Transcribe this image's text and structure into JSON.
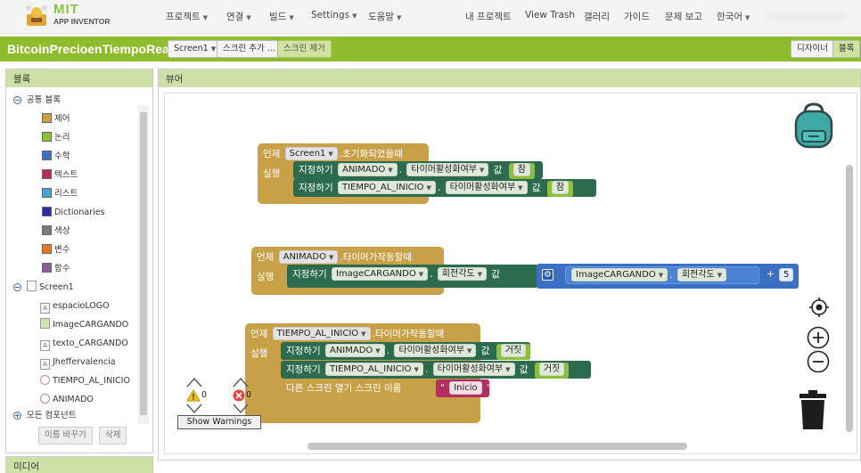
{
  "app": {
    "logo_mit": "MIT",
    "logo_sub": "APP INVENTOR"
  },
  "topmenu": {
    "left": [
      "프로젝트",
      "연결",
      "빌드",
      "Settings",
      "도움말"
    ],
    "right": [
      "내 프로젝트",
      "View Trash",
      "갤러리",
      "가이드",
      "문제 보고",
      "한국어"
    ]
  },
  "project": {
    "title": "BitcoinPrecioenTiempoReal",
    "screen_select": "Screen1",
    "add_screen": "스크린 추가 ...",
    "remove_screen": "스크린 제거",
    "designer": "디자이너",
    "blocks": "블록"
  },
  "palette": {
    "header": "블록",
    "builtin": "공통 블록",
    "builtin_items": [
      {
        "label": "제어",
        "color": "#c8a047"
      },
      {
        "label": "논리",
        "color": "#8dbf3f"
      },
      {
        "label": "수학",
        "color": "#3a6fc2"
      },
      {
        "label": "텍스트",
        "color": "#b32d5e"
      },
      {
        "label": "리스트",
        "color": "#4aa3cf"
      },
      {
        "label": "Dictionaries",
        "color": "#2d2d9c"
      },
      {
        "label": "색상",
        "color": "#7a7a7a"
      },
      {
        "label": "변수",
        "color": "#e07b2c"
      },
      {
        "label": "함수",
        "color": "#8c5a9e"
      }
    ],
    "screen": "Screen1",
    "components": [
      {
        "label": "espacioLOGO",
        "icon": "label-icon"
      },
      {
        "label": "ImageCARGANDO",
        "icon": "image-icon"
      },
      {
        "label": "texto_CARGANDO",
        "icon": "label-icon"
      },
      {
        "label": "Jheffervalencia",
        "icon": "label-icon"
      },
      {
        "label": "TIEMPO_AL_INICIO",
        "icon": "clock-icon"
      },
      {
        "label": "ANIMADO",
        "icon": "clock-icon"
      }
    ],
    "all_components": "모든 컴포넌트",
    "rename": "이름 바꾸기",
    "delete": "삭제",
    "media": "미디어"
  },
  "viewer": {
    "header": "뷰어",
    "block1": {
      "when": "언제",
      "component": "Screen1",
      "event": ".초기화되었을때",
      "do": "실행",
      "set": "지정하기",
      "s1_comp": "ANIMADO",
      "s1_prop": "타이머활성화여부",
      "s1_to": "값",
      "s1_val": "참",
      "s2_comp": "TIEMPO_AL_INICIO",
      "s2_prop": "타이머활성화여부",
      "s2_to": "값",
      "s2_val": "참"
    },
    "block2": {
      "when": "언제",
      "component": "ANIMADO",
      "event": ".타이머가작동할때",
      "do": "실행",
      "set": "지정하기",
      "s1_comp": "ImageCARGANDO",
      "s1_prop": "회전각도",
      "s1_to": "값",
      "get_comp": "ImageCARGANDO",
      "get_prop": "회전각도",
      "op": "+",
      "num": "5"
    },
    "block3": {
      "when": "언제",
      "component": "TIEMPO_AL_INICIO",
      "event": ".타이머가작동할때",
      "do": "실행",
      "set": "지정하기",
      "s1_comp": "ANIMADO",
      "s1_prop": "타이머활성화여부",
      "s1_to": "값",
      "s1_val": "거짓",
      "s2_comp": "TIEMPO_AL_INICIO",
      "s2_prop": "타이머활성화여부",
      "s2_to": "값",
      "s2_val": "거짓",
      "open_screen": "다른 스크린 열기  스크린 이름",
      "quote_open": "\"",
      "screen_name": "Inicio",
      "quote_close": "\""
    },
    "warnings_count": "0",
    "errors_count": "0",
    "show_warnings": "Show Warnings"
  }
}
